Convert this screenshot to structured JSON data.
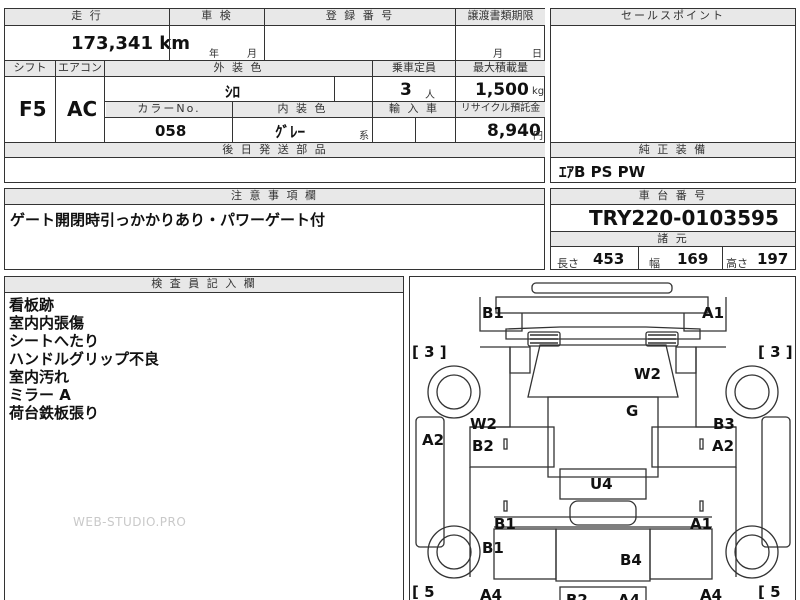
{
  "main_table": {
    "top_row_labels": {
      "mileage": "走 行",
      "inspection": "車 検",
      "registration": "登 録 番 号",
      "transfer_deadline": "譲渡書類期限",
      "sales_point": "セールスポイント"
    },
    "mileage_value": "173,341 km",
    "inspection_year": "年",
    "inspection_month": "月",
    "transfer_month": "月",
    "transfer_day": "日",
    "second_row_labels": {
      "shift": "シフト",
      "aircon": "エアコン",
      "exterior_color": "外 装 色",
      "capacity": "乗車定員",
      "max_load": "最大積載量"
    },
    "shift_value": "F5",
    "aircon_value": "AC",
    "exterior_color_value": "ｼﾛ",
    "capacity_value": "3",
    "capacity_unit": "人",
    "max_load_value": "1,500",
    "max_load_unit": "kg",
    "third_row_labels": {
      "color_no": "カラーNo.",
      "interior_color": "内 装 色",
      "import": "輸 入 車",
      "recycle": "リサイクル預託金"
    },
    "color_no_value": "058",
    "interior_color_value": "ｸﾞﾚｰ",
    "interior_color_suffix": "系",
    "recycle_value": "8,940",
    "recycle_unit": "円",
    "later_parts_label": "後 日 発 送 部 品"
  },
  "options": {
    "label": "純 正 装 備",
    "value": "ｴｱB PS PW"
  },
  "notes": {
    "label": "注 意 事 項 欄",
    "value": "ゲート開閉時引っかかりあり・パワーゲート付"
  },
  "chassis": {
    "label": "車 台 番 号",
    "value": "TRY220-0103595"
  },
  "specs": {
    "label": "諸 元",
    "length_label": "長さ",
    "length_value": "453",
    "width_label": "幅",
    "width_value": "169",
    "height_label": "高さ",
    "height_value": "197"
  },
  "inspector": {
    "label": "検 査 員 記 入 欄",
    "lines": [
      "看板跡",
      "室内内張傷",
      "シートへたり",
      "ハンドルグリップ不良",
      "室内汚れ",
      "ミラー A",
      "荷台鉄板張り"
    ]
  },
  "diagram_marks": {
    "b1_top": "B1",
    "a1_top": "A1",
    "left_bracket_top": "[ 3 ]",
    "right_bracket_top": "[ 3 ]",
    "w2_right": "W2",
    "g": "G",
    "w2_left": "W2",
    "b3": "B3",
    "a2_left": "A2",
    "b2_left": "B2",
    "a2_right": "A2",
    "u4": "U4",
    "b1_mid_left": "B1",
    "a1_mid_right": "A1",
    "b1_low_left": "B1",
    "b4": "B4",
    "left_bracket_bottom": "[ 5",
    "right_bracket_bottom": "[ 5",
    "a4_left": "A4",
    "b2_bottom": "B2",
    "a4_center": "A4",
    "a4_right": "A4"
  },
  "watermark": "WEB-STUDIO.PRO",
  "colors": {
    "label_bg": "#e8e8e8",
    "border": "#333333"
  }
}
